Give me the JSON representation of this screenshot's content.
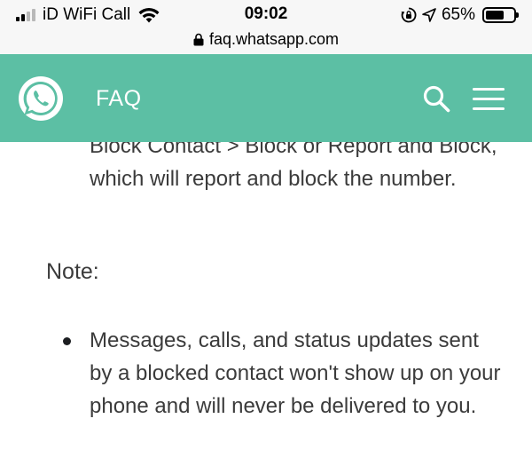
{
  "status_bar": {
    "carrier": "iD WiFi Call",
    "time": "09:02",
    "battery_percent": "65%",
    "battery_level": 0.65,
    "signal_bars_active": 2,
    "signal_bars_total": 4,
    "icons": [
      "signal-icon",
      "wifi-icon",
      "orientation-lock-icon",
      "location-arrow-icon",
      "battery-icon"
    ]
  },
  "browser": {
    "url": "faq.whatsapp.com",
    "secure_icon": "padlock-icon"
  },
  "header": {
    "logo_icon": "whatsapp-logo-icon",
    "title": "FAQ",
    "background_color": "#5cbfa4",
    "search_icon": "search-icon",
    "menu_icon": "menu-icon"
  },
  "content": {
    "paragraph": "Block Contact > Block or Report and Block, which will report and block the number.",
    "note_heading": "Note:",
    "bullets": [
      "Messages, calls, and status updates sent by a blocked contact won't show up on your phone and will never be delivered to you."
    ]
  }
}
